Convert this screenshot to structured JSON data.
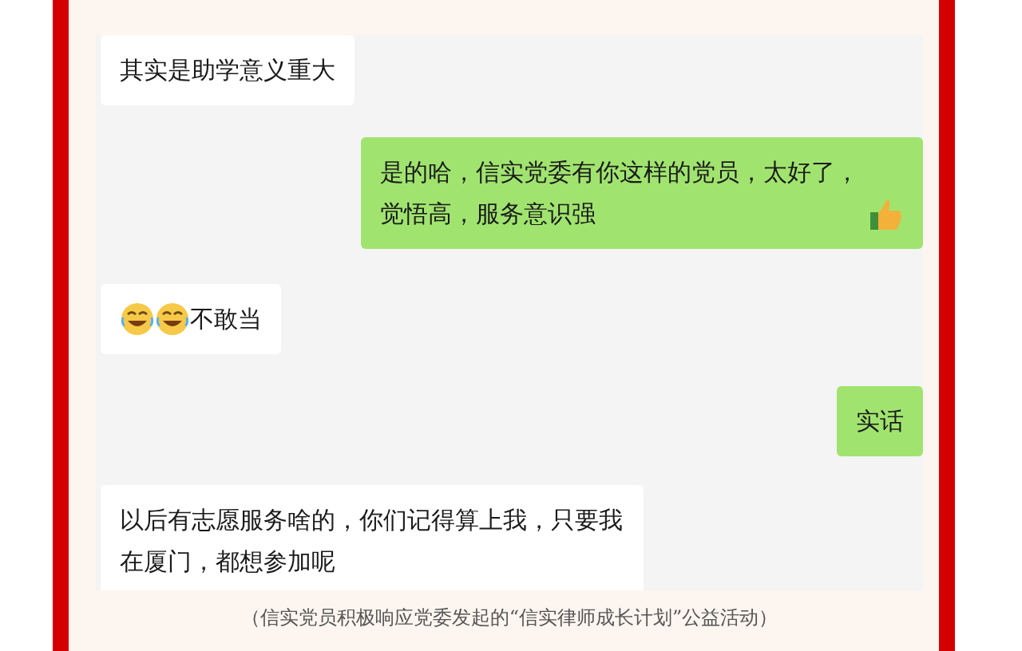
{
  "chat": {
    "messages": [
      {
        "outgoing": false,
        "kind": "plain",
        "text": "其实是助学意义重大"
      },
      {
        "outgoing": true,
        "kind": "emoji_suffix",
        "text": "是的哈，信实党委有你这样的党员，太好了，觉悟高，服务意识强"
      },
      {
        "outgoing": false,
        "kind": "emoji_prefix",
        "text": "不敢当"
      },
      {
        "outgoing": true,
        "kind": "plain",
        "text": "实话"
      },
      {
        "outgoing": false,
        "kind": "plain",
        "text": "以后有志愿服务啥的，你们记得算上我，只要我在厦门，都想参加呢"
      }
    ]
  },
  "caption": "（信实党员积极响应党委发起的“信实律师成长计划”公益活动）"
}
